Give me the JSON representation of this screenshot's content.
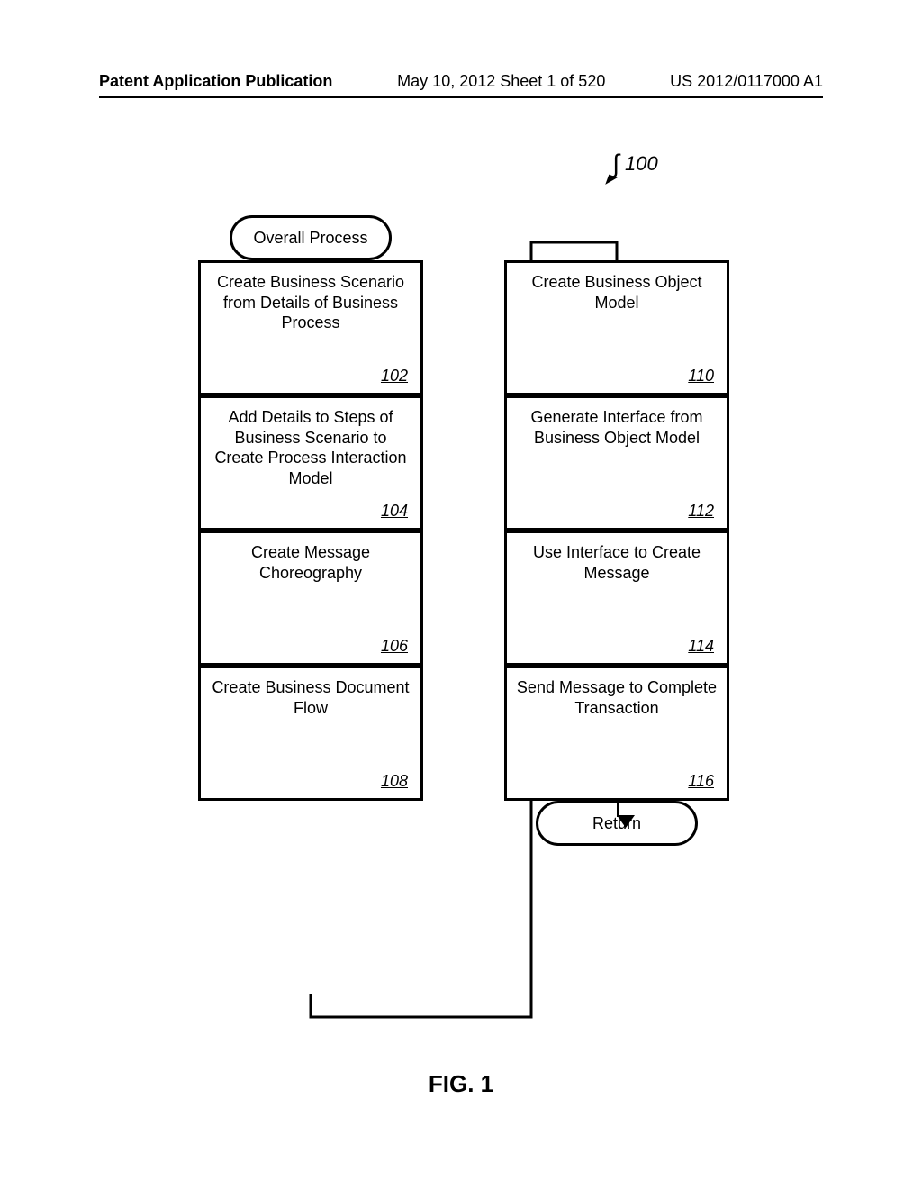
{
  "header": {
    "left": "Patent Application Publication",
    "center": "May 10, 2012  Sheet 1 of 520",
    "right": "US 2012/0117000 A1"
  },
  "figure_ref": "100",
  "terminator_start": "Overall Process",
  "terminator_end": "Return",
  "figure_label": "FIG. 1",
  "left_boxes": [
    {
      "text": "Create Business Scenario from Details of Business Process",
      "ref": "102"
    },
    {
      "text": "Add Details to Steps of Business Scenario to Create Process Interaction Model",
      "ref": "104"
    },
    {
      "text": "Create Message Choreography",
      "ref": "106"
    },
    {
      "text": "Create Business Document Flow",
      "ref": "108"
    }
  ],
  "right_boxes": [
    {
      "text": "Create Business Object Model",
      "ref": "110"
    },
    {
      "text": "Generate Interface from Business Object Model",
      "ref": "112"
    },
    {
      "text": "Use Interface to Create Message",
      "ref": "114"
    },
    {
      "text": "Send Message to Complete Transaction",
      "ref": "116"
    }
  ],
  "chart_data": {
    "type": "flowchart",
    "title": "FIG. 1",
    "reference_number": "100",
    "nodes": [
      {
        "id": "start",
        "type": "terminator",
        "label": "Overall Process"
      },
      {
        "id": "102",
        "type": "process",
        "label": "Create Business Scenario from Details of Business Process",
        "ref": "102"
      },
      {
        "id": "104",
        "type": "process",
        "label": "Add Details to Steps of Business Scenario to Create Process Interaction Model",
        "ref": "104"
      },
      {
        "id": "106",
        "type": "process",
        "label": "Create Message Choreography",
        "ref": "106"
      },
      {
        "id": "108",
        "type": "process",
        "label": "Create Business Document Flow",
        "ref": "108"
      },
      {
        "id": "110",
        "type": "process",
        "label": "Create Business Object Model",
        "ref": "110"
      },
      {
        "id": "112",
        "type": "process",
        "label": "Generate Interface from Business Object Model",
        "ref": "112"
      },
      {
        "id": "114",
        "type": "process",
        "label": "Use Interface to Create Message",
        "ref": "114"
      },
      {
        "id": "116",
        "type": "process",
        "label": "Send Message to Complete Transaction",
        "ref": "116"
      },
      {
        "id": "end",
        "type": "terminator",
        "label": "Return"
      }
    ],
    "edges": [
      {
        "from": "start",
        "to": "102"
      },
      {
        "from": "102",
        "to": "104"
      },
      {
        "from": "104",
        "to": "106"
      },
      {
        "from": "106",
        "to": "108"
      },
      {
        "from": "108",
        "to": "110"
      },
      {
        "from": "110",
        "to": "112"
      },
      {
        "from": "112",
        "to": "114"
      },
      {
        "from": "114",
        "to": "116"
      },
      {
        "from": "116",
        "to": "end"
      }
    ]
  }
}
